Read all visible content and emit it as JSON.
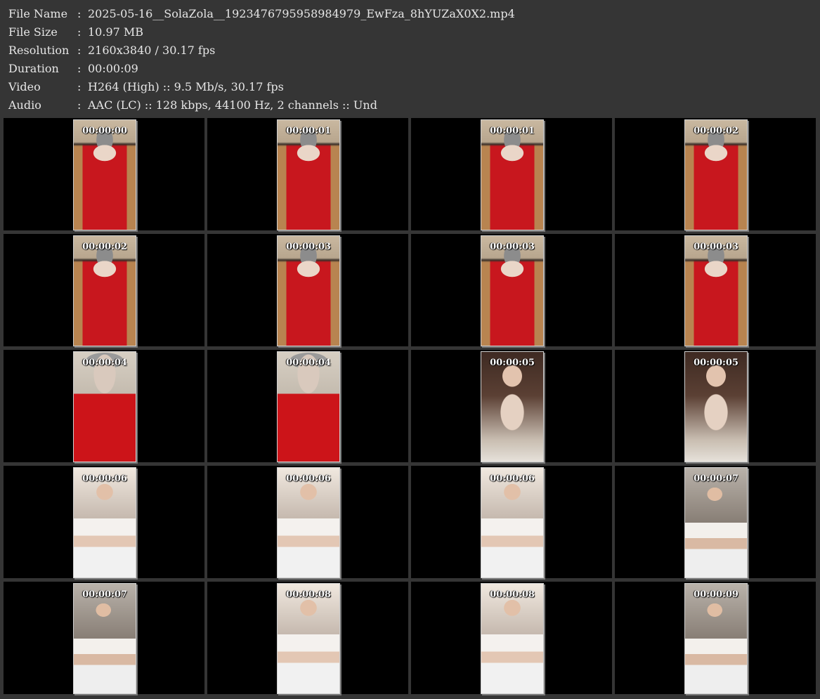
{
  "header": {
    "rows": [
      {
        "label": "File Name",
        "value": "2025-05-16__SolaZola__1923476795958984979_EwFza_8hYUZaX0X2.mp4"
      },
      {
        "label": "File Size",
        "value": "10.97 MB"
      },
      {
        "label": "Resolution",
        "value": "2160x3840 / 30.17 fps"
      },
      {
        "label": "Duration",
        "value": "00:00:09"
      },
      {
        "label": "Video",
        "value": "H264 (High) :: 9.5 Mb/s, 30.17 fps"
      },
      {
        "label": "Audio",
        "value": "AAC (LC) :: 128 kbps, 44100 Hz, 2 channels :: Und"
      }
    ],
    "separator": ":"
  },
  "thumbnails": [
    {
      "time": "00:00:00",
      "scene": "a"
    },
    {
      "time": "00:00:01",
      "scene": "a"
    },
    {
      "time": "00:00:01",
      "scene": "a"
    },
    {
      "time": "00:00:02",
      "scene": "a"
    },
    {
      "time": "00:00:02",
      "scene": "a"
    },
    {
      "time": "00:00:03",
      "scene": "a"
    },
    {
      "time": "00:00:03",
      "scene": "a"
    },
    {
      "time": "00:00:03",
      "scene": "a"
    },
    {
      "time": "00:00:04",
      "scene": "b"
    },
    {
      "time": "00:00:04",
      "scene": "b"
    },
    {
      "time": "00:00:05",
      "scene": "c"
    },
    {
      "time": "00:00:05",
      "scene": "c"
    },
    {
      "time": "00:00:06",
      "scene": "d"
    },
    {
      "time": "00:00:06",
      "scene": "d"
    },
    {
      "time": "00:00:06",
      "scene": "d"
    },
    {
      "time": "00:00:07",
      "scene": "e"
    },
    {
      "time": "00:00:07",
      "scene": "e"
    },
    {
      "time": "00:00:08",
      "scene": "d"
    },
    {
      "time": "00:00:08",
      "scene": "d"
    },
    {
      "time": "00:00:09",
      "scene": "e"
    }
  ]
}
